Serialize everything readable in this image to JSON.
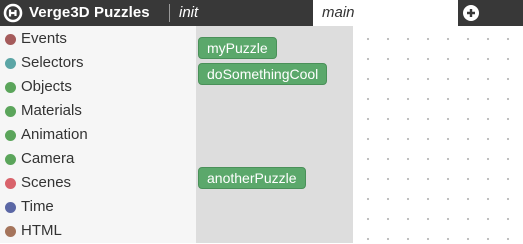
{
  "app": {
    "title": "Verge3D Puzzles",
    "logo_icon": "verge3d-logo-icon"
  },
  "tabs": [
    {
      "label": "init",
      "active": false
    },
    {
      "label": "main",
      "active": true
    }
  ],
  "add_tab_icon": "plus-circle-icon",
  "categories": [
    {
      "label": "Events",
      "color": "#a55b5b"
    },
    {
      "label": "Selectors",
      "color": "#5ba5a5"
    },
    {
      "label": "Objects",
      "color": "#5ba55b"
    },
    {
      "label": "Materials",
      "color": "#5ba55b"
    },
    {
      "label": "Animation",
      "color": "#5ba55b"
    },
    {
      "label": "Camera",
      "color": "#5ba55b"
    },
    {
      "label": "Scenes",
      "color": "#d9636b"
    },
    {
      "label": "Time",
      "color": "#5b67a5"
    },
    {
      "label": "HTML",
      "color": "#a5745b"
    }
  ],
  "flyout_blocks": [
    {
      "label": "myPuzzle",
      "color": "#5ba86b"
    },
    {
      "label": "doSomethingCool",
      "color": "#5ba86b"
    },
    {
      "label": "anotherPuzzle",
      "color": "#5ba86b"
    }
  ]
}
